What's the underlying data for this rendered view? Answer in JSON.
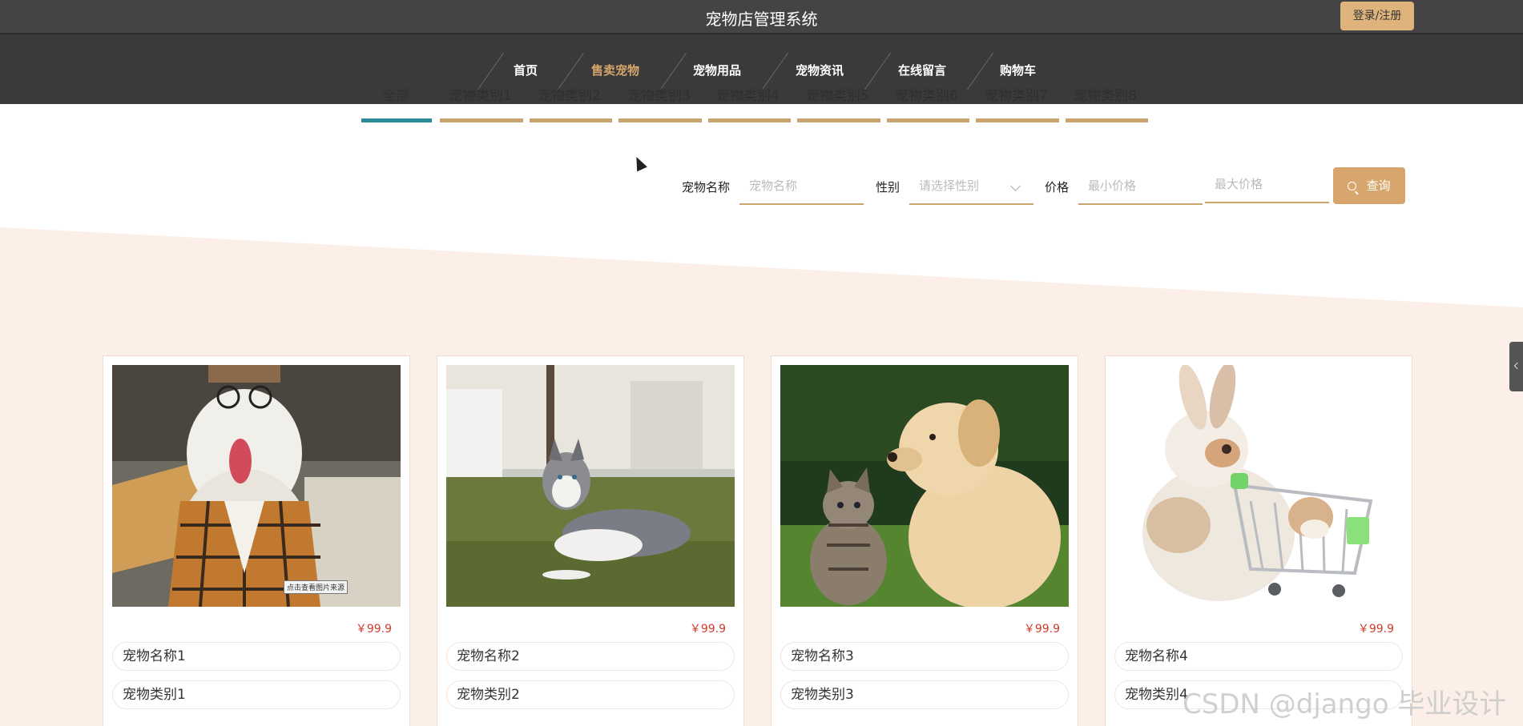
{
  "header": {
    "app_title": "宠物店管理系统",
    "login_label": "登录/注册"
  },
  "nav": {
    "items": [
      {
        "label": "首页",
        "active": false
      },
      {
        "label": "售卖宠物",
        "active": true
      },
      {
        "label": "宠物用品",
        "active": false
      },
      {
        "label": "宠物资讯",
        "active": false
      },
      {
        "label": "在线留言",
        "active": false
      },
      {
        "label": "购物车",
        "active": false
      }
    ],
    "active_color": "#d7a66c"
  },
  "categories": {
    "items": [
      "全部",
      "宠物类别1",
      "宠物类别2",
      "宠物类别3",
      "宠物类别4",
      "宠物类别5",
      "宠物类别6",
      "宠物类别7",
      "宠物类别8"
    ],
    "selected": "全部"
  },
  "search": {
    "name_label": "宠物名称",
    "name_placeholder": "宠物名称",
    "gender_label": "性别",
    "gender_placeholder": "请选择性别",
    "price_label": "价格",
    "min_price_placeholder": "最小价格",
    "max_price_placeholder": "最大价格",
    "button_label": "查询"
  },
  "products": [
    {
      "name": "宠物名称1",
      "category": "宠物类别1",
      "price": "￥99.9",
      "image": "white dog in plaid jacket and glasses",
      "image_tag": "点击查看图片来源"
    },
    {
      "name": "宠物名称2",
      "category": "宠物类别2",
      "price": "￥99.9",
      "image": "husky lying on grass"
    },
    {
      "name": "宠物名称3",
      "category": "宠物类别3",
      "price": "￥99.9",
      "image": "kitten and puppy on grass"
    },
    {
      "name": "宠物名称4",
      "category": "宠物类别4",
      "price": "￥99.9",
      "image": "rabbit with shopping cart and hamster"
    }
  ],
  "watermark": "CSDN @django 毕业设计",
  "colors": {
    "accent": "#c9a46e",
    "selected_tab": "#2b8a98",
    "price": "#d33a2c",
    "band": "#fbefe8"
  }
}
